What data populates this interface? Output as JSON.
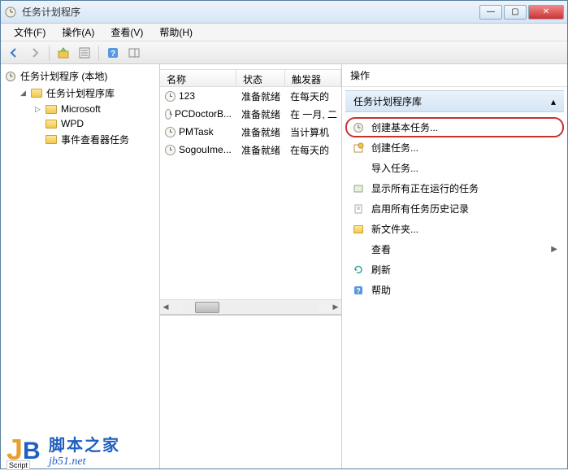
{
  "titlebar": {
    "title": "任务计划程序"
  },
  "menubar": {
    "file": "文件(F)",
    "action": "操作(A)",
    "view": "查看(V)",
    "help": "帮助(H)"
  },
  "tree": {
    "root": "任务计划程序 (本地)",
    "library": "任务计划程序库",
    "items": [
      {
        "label": "Microsoft"
      },
      {
        "label": "WPD"
      },
      {
        "label": "事件查看器任务"
      }
    ]
  },
  "list": {
    "headers": {
      "name": "名称",
      "status": "状态",
      "trigger": "触发器"
    },
    "rows": [
      {
        "name": "123",
        "status": "准备就绪",
        "trigger": "在每天的"
      },
      {
        "name": "PCDoctorB...",
        "status": "准备就绪",
        "trigger": "在 一月, 二"
      },
      {
        "name": "PMTask",
        "status": "准备就绪",
        "trigger": "当计算机"
      },
      {
        "name": "SogouIme...",
        "status": "准备就绪",
        "trigger": "在每天的"
      }
    ]
  },
  "actions": {
    "title": "操作",
    "header": "任务计划程序库",
    "items": [
      {
        "icon": "clock-icon",
        "label": "创建基本任务...",
        "highlighted": true
      },
      {
        "icon": "task-new-icon",
        "label": "创建任务..."
      },
      {
        "icon": "import-icon",
        "label": "导入任务..."
      },
      {
        "icon": "running-icon",
        "label": "显示所有正在运行的任务"
      },
      {
        "icon": "history-icon",
        "label": "启用所有任务历史记录"
      },
      {
        "icon": "folder-new-icon",
        "label": "新文件夹..."
      },
      {
        "icon": "view-icon",
        "label": "查看",
        "arrow": true
      },
      {
        "icon": "refresh-icon",
        "label": "刷新"
      },
      {
        "icon": "help-icon",
        "label": "帮助"
      }
    ]
  },
  "watermark": {
    "script": "Script",
    "cn": "脚本之家",
    "url": "jb51.net"
  }
}
